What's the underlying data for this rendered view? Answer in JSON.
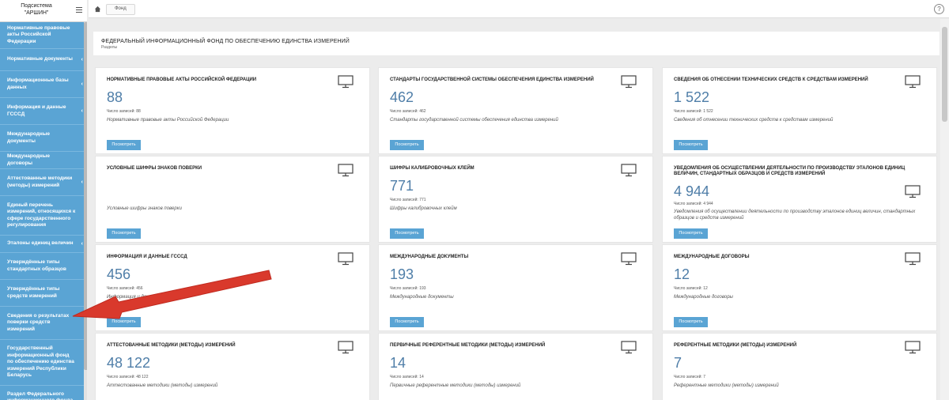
{
  "sidebar": {
    "brand_line1": "Подсистема",
    "brand_line2": "\"АРШИН\"",
    "items": [
      {
        "label": "Нормативные правовые акты Российской Федерации",
        "chevron": false
      },
      {
        "label": "Нормативные документы",
        "chevron": true
      },
      {
        "label": "Информационные базы данных",
        "chevron": true
      },
      {
        "label": "Информация и данные ГСССД",
        "chevron": true
      },
      {
        "label": "Международные документы",
        "chevron": false
      },
      {
        "label": "Международные договоры",
        "chevron": false
      },
      {
        "label": "Аттестованные методики (методы) измерений",
        "chevron": true
      },
      {
        "label": "Единый перечень измерений, относящихся к сфере государственного регулирования",
        "chevron": false
      },
      {
        "label": "Эталоны единиц величин",
        "chevron": true
      },
      {
        "label": "Утверждённые типы стандартных образцов",
        "chevron": false
      },
      {
        "label": "Утверждённые типы средств измерений",
        "chevron": false
      },
      {
        "label": "Сведения о результатах поверки средств измерений",
        "chevron": false
      },
      {
        "label": "Государственный информационный фонд по обеспечению единства измерений Республики Беларусь",
        "chevron": false
      },
      {
        "label": "Раздел Федерального информационного фонда по обеспечению единства",
        "chevron": false
      }
    ],
    "chevron_glyph": "‹"
  },
  "topbar": {
    "crumb": "Фонд",
    "help": "?"
  },
  "header": {
    "title": "ФЕДЕРАЛЬНЫЙ ИНФОРМАЦИОННЫЙ ФОНД ПО ОБЕСПЕЧЕНИЮ ЕДИНСТВА ИЗМЕРЕНИЙ",
    "subtitle": "Разделы"
  },
  "cards": [
    {
      "title": "НОРМАТИВНЫЕ ПРАВОВЫЕ АКТЫ РОССИЙСКОЙ ФЕДЕРАЦИИ",
      "count": "88",
      "records": "Число записей: 88",
      "desc": "Нормативные правовые акты Российской Федерации",
      "button": "Посмотреть"
    },
    {
      "title": "СТАНДАРТЫ ГОСУДАРСТВЕННОЙ СИСТЕМЫ ОБЕСПЕЧЕНИЯ ЕДИНСТВА ИЗМЕРЕНИЙ",
      "count": "462",
      "records": "Число записей: 462",
      "desc": "Стандарты государственной системы обеспечения единства измерений",
      "button": "Посмотреть"
    },
    {
      "title": "СВЕДЕНИЯ ОБ ОТНЕСЕНИИ ТЕХНИЧЕСКИХ СРЕДСТВ К СРЕДСТВАМ ИЗМЕРЕНИЙ",
      "count": "1 522",
      "records": "Число записей: 1 522",
      "desc": "Сведения об отнесении технических средств к средствам измерений",
      "button": "Посмотреть"
    },
    {
      "title": "УСЛОВНЫЕ ШИФРЫ ЗНАКОВ ПОВЕРКИ",
      "count": "",
      "records": "",
      "desc": "Условные шифры знаков поверки",
      "button": "Посмотреть"
    },
    {
      "title": "ШИФРЫ КАЛИБРОВОЧНЫХ КЛЕЙМ",
      "count": "771",
      "records": "Число записей: 771",
      "desc": "Шифры калибровочных клейм",
      "button": "Посмотреть"
    },
    {
      "title": "УВЕДОМЛЕНИЯ ОБ ОСУЩЕСТВЛЕНИИ ДЕЯТЕЛЬНОСТИ ПО ПРОИЗВОДСТВУ ЭТАЛОНОВ ЕДИНИЦ ВЕЛИЧИН, СТАНДАРТНЫХ ОБРАЗЦОВ И СРЕДСТВ ИЗМЕРЕНИЙ",
      "count": "4 944",
      "records": "Число записей: 4 944",
      "desc": "Уведомления об осуществлении деятельности по производству эталонов единиц величин, стандартных образцов и средств измерений",
      "button": "Посмотреть"
    },
    {
      "title": "ИНФОРМАЦИЯ И ДАННЫЕ ГСССД",
      "count": "456",
      "records": "Число записей: 456",
      "desc": "Информация и данные ГСССД",
      "button": "Посмотреть"
    },
    {
      "title": "МЕЖДУНАРОДНЫЕ ДОКУМЕНТЫ",
      "count": "193",
      "records": "Число записей: 193",
      "desc": "Международные документы",
      "button": "Посмотреть"
    },
    {
      "title": "МЕЖДУНАРОДНЫЕ ДОГОВОРЫ",
      "count": "12",
      "records": "Число записей: 12",
      "desc": "Международные договоры",
      "button": "Посмотреть"
    },
    {
      "title": "АТТЕСТОВАННЫЕ МЕТОДИКИ (МЕТОДЫ) ИЗМЕРЕНИЙ",
      "count": "48 122",
      "records": "Число записей: 48 122",
      "desc": "Аттестованные методики (методы) измерений",
      "button": "Посмотреть"
    },
    {
      "title": "ПЕРВИЧНЫЕ РЕФЕРЕНТНЫЕ МЕТОДИКИ (МЕТОДЫ) ИЗМЕРЕНИЙ",
      "count": "14",
      "records": "Число записей: 14",
      "desc": "Первичные референтные методики (методы) измерений",
      "button": "Посмотреть"
    },
    {
      "title": "РЕФЕРЕНТНЫЕ МЕТОДИКИ (МЕТОДЫ) ИЗМЕРЕНИЙ",
      "count": "7",
      "records": "Число записей: 7",
      "desc": "Референтные методики (методы) измерений",
      "button": "Посмотреть"
    }
  ],
  "colors": {
    "sidebar": "#5aa4d4",
    "accent_number": "#4f7ea8",
    "annotation_arrow": "#d9392c"
  }
}
